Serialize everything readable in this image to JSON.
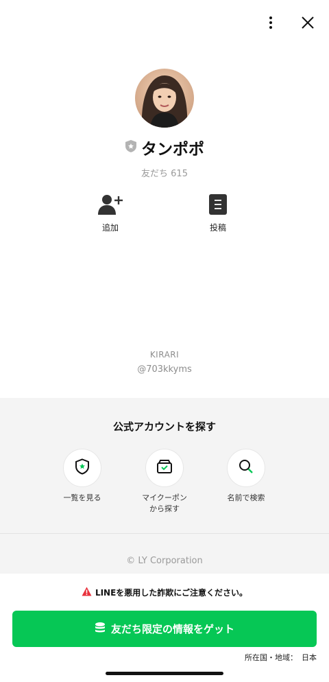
{
  "header": {
    "more_icon": "more-vertical-icon",
    "close_icon": "close-icon"
  },
  "profile": {
    "name": "タンポポ",
    "friends_label": "友だち 615",
    "badge_icon": "verified-shield-icon"
  },
  "actions": [
    {
      "label": "追加",
      "icon": "add-friend-icon"
    },
    {
      "label": "投稿",
      "icon": "post-icon"
    }
  ],
  "account": {
    "name": "KIRARI",
    "id": "@703kkyms"
  },
  "explore": {
    "title": "公式アカウントを探す",
    "items": [
      {
        "label": "一覧を見る",
        "icon": "shield-star-icon"
      },
      {
        "label": "マイクーポン\nから探す",
        "icon": "coupon-box-icon"
      },
      {
        "label": "名前で検索",
        "icon": "search-icon"
      }
    ],
    "copyright": "© LY Corporation"
  },
  "bottom": {
    "warning": "LINEを悪用した詐欺にご注意ください。",
    "cta_label": "友だち限定の情報をゲット",
    "region_label": "所在国・地域：",
    "region_value": "日本"
  },
  "colors": {
    "accent": "#06c755",
    "warning_red": "#e8313c",
    "muted_text": "#9a9a9a",
    "panel_bg": "#f4f4f4"
  }
}
